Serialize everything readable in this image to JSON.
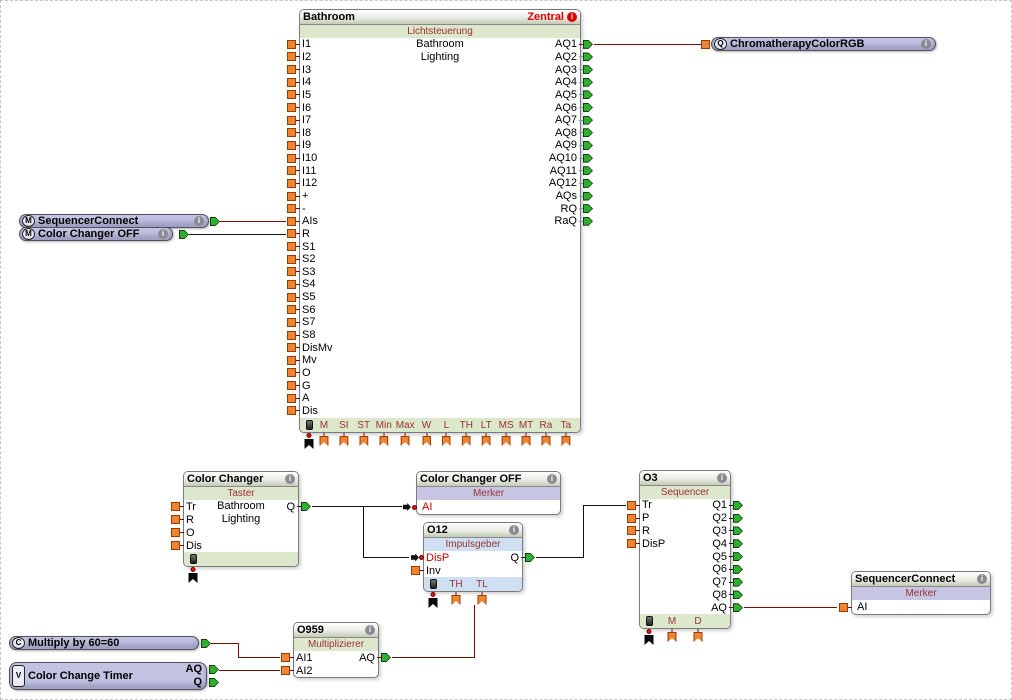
{
  "icons": {
    "info_glyph": "i"
  },
  "colors": {
    "wire_analog": "#7a0909",
    "wire_digital": "#111111",
    "pin_input_orange": "#ee8532",
    "pin_output_green": "#2fae2f",
    "block_green_bar": "#dce8cc",
    "merker_lavender": "#c6c6e4",
    "impulsgeber_blue": "#cddff0",
    "label_maroon": "#9c3030",
    "status_red": "#dd0000",
    "pill_lavender": "#c2c2e2"
  },
  "blocks": {
    "lichtsteuerung": {
      "title": "Bathroom",
      "status": "Zentral",
      "subtitle": "Lichtsteuerung",
      "body_line1": "Bathroom",
      "body_line2": "Lighting",
      "inputs": [
        "I1",
        "I2",
        "I3",
        "I4",
        "I5",
        "I6",
        "I7",
        "I8",
        "I9",
        "I10",
        "I11",
        "I12",
        "+",
        "-",
        "AIs",
        "R",
        "S1",
        "S2",
        "S3",
        "S4",
        "S5",
        "S6",
        "S7",
        "S8",
        "DisMv",
        "Mv",
        "O",
        "G",
        "A",
        "Dis"
      ],
      "outputs": [
        "AQ1",
        "AQ2",
        "AQ3",
        "AQ4",
        "AQ5",
        "AQ6",
        "AQ7",
        "AQ8",
        "AQ9",
        "AQ10",
        "AQ11",
        "AQ12",
        "AQs",
        "RQ",
        "RaQ"
      ],
      "params": [
        "M",
        "SI",
        "ST",
        "Min",
        "Max",
        "W",
        "L",
        "TH",
        "LT",
        "MS",
        "MT",
        "Ra",
        "Ta"
      ]
    },
    "color_changer": {
      "title": "Color Changer",
      "subtitle": "Taster",
      "body_line1": "Bathroom",
      "body_line2": "Lighting",
      "inputs": [
        "Tr",
        "R",
        "O",
        "Dis"
      ],
      "outputs": [
        "Q"
      ]
    },
    "color_changer_off": {
      "title": "Color Changer OFF",
      "subtitle": "Merker",
      "input": "AI"
    },
    "o12": {
      "title": "O12",
      "subtitle": "Impulsgeber",
      "input_connected": "DisP",
      "input2": "Inv",
      "output": "Q",
      "params": [
        "TH",
        "TL"
      ]
    },
    "o3": {
      "title": "O3",
      "subtitle": "Sequencer",
      "inputs": [
        "Tr",
        "P",
        "R",
        "DisP"
      ],
      "outputs": [
        "Q1",
        "Q2",
        "Q3",
        "Q4",
        "Q5",
        "Q6",
        "Q7",
        "Q8",
        "AQ"
      ],
      "params": [
        "M",
        "D"
      ]
    },
    "o959": {
      "title": "O959",
      "subtitle": "Multiplizierer",
      "inputs": [
        "AI1",
        "AI2"
      ],
      "outputs": [
        "AQ"
      ]
    },
    "sequencer_connect_merker": {
      "title": "SequencerConnect",
      "subtitle": "Merker",
      "input": "AI"
    }
  },
  "pills": {
    "sequencer_connect": {
      "badge": "M",
      "label": "SequencerConnect"
    },
    "color_changer_off": {
      "badge": "M",
      "label": "Color Changer OFF"
    },
    "chromatherapy": {
      "badge": "Q",
      "label": "ChromatherapyColorRGB"
    },
    "multiply": {
      "badge": "C",
      "label": "Multiply by 60=60"
    },
    "color_change_timer": {
      "badge": "V",
      "label": "Color Change Timer",
      "out1": "AQ",
      "out2": "Q"
    }
  }
}
